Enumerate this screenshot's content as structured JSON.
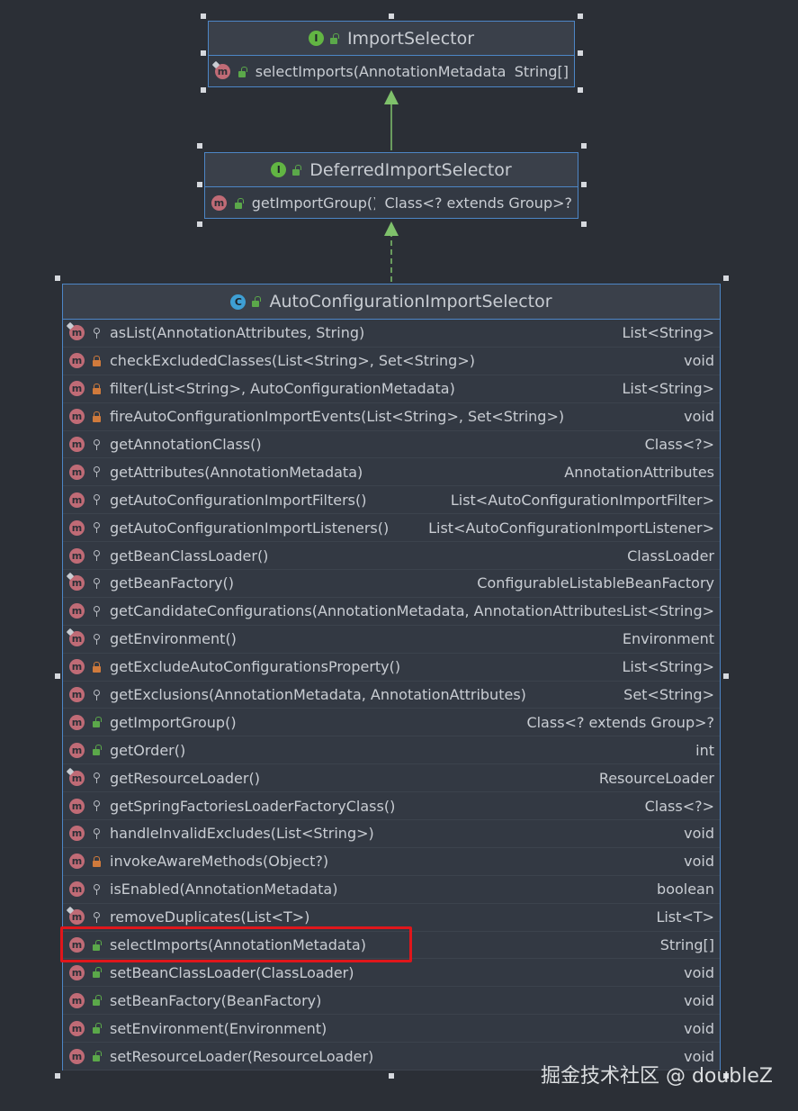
{
  "nodes": {
    "import_selector": {
      "kind_letter": "I",
      "title": "ImportSelector",
      "methods": [
        {
          "name": "selectImports(AnnotationMetadata)",
          "returns": "String[]",
          "visibility": "public",
          "abstract": true
        }
      ]
    },
    "deferred_import_selector": {
      "kind_letter": "I",
      "title": "DeferredImportSelector",
      "methods": [
        {
          "name": "getImportGroup()",
          "returns": "Class<? extends Group>?",
          "visibility": "public",
          "abstract": false
        }
      ]
    },
    "auto_configuration_import_selector": {
      "kind_letter": "C",
      "title": "AutoConfigurationImportSelector",
      "methods": [
        {
          "name": "asList(AnnotationAttributes, String)",
          "returns": "List<String>",
          "visibility": "protected",
          "abstract": true
        },
        {
          "name": "checkExcludedClasses(List<String>, Set<String>)",
          "returns": "void",
          "visibility": "private",
          "abstract": false
        },
        {
          "name": "filter(List<String>, AutoConfigurationMetadata)",
          "returns": "List<String>",
          "visibility": "private",
          "abstract": false
        },
        {
          "name": "fireAutoConfigurationImportEvents(List<String>, Set<String>)",
          "returns": "void",
          "visibility": "private",
          "abstract": false
        },
        {
          "name": "getAnnotationClass()",
          "returns": "Class<?>",
          "visibility": "protected",
          "abstract": false
        },
        {
          "name": "getAttributes(AnnotationMetadata)",
          "returns": "AnnotationAttributes",
          "visibility": "protected",
          "abstract": false
        },
        {
          "name": "getAutoConfigurationImportFilters()",
          "returns": "List<AutoConfigurationImportFilter>",
          "visibility": "protected",
          "abstract": false
        },
        {
          "name": "getAutoConfigurationImportListeners()",
          "returns": "List<AutoConfigurationImportListener>",
          "visibility": "protected",
          "abstract": false
        },
        {
          "name": "getBeanClassLoader()",
          "returns": "ClassLoader",
          "visibility": "protected",
          "abstract": false
        },
        {
          "name": "getBeanFactory()",
          "returns": "ConfigurableListableBeanFactory",
          "visibility": "protected",
          "abstract": true
        },
        {
          "name": "getCandidateConfigurations(AnnotationMetadata, AnnotationAttributes)",
          "returns": "List<String>",
          "visibility": "protected",
          "abstract": false
        },
        {
          "name": "getEnvironment()",
          "returns": "Environment",
          "visibility": "protected",
          "abstract": true
        },
        {
          "name": "getExcludeAutoConfigurationsProperty()",
          "returns": "List<String>",
          "visibility": "private",
          "abstract": false
        },
        {
          "name": "getExclusions(AnnotationMetadata, AnnotationAttributes)",
          "returns": "Set<String>",
          "visibility": "protected",
          "abstract": false
        },
        {
          "name": "getImportGroup()",
          "returns": "Class<? extends Group>?",
          "visibility": "public",
          "abstract": false
        },
        {
          "name": "getOrder()",
          "returns": "int",
          "visibility": "public",
          "abstract": false
        },
        {
          "name": "getResourceLoader()",
          "returns": "ResourceLoader",
          "visibility": "protected",
          "abstract": true
        },
        {
          "name": "getSpringFactoriesLoaderFactoryClass()",
          "returns": "Class<?>",
          "visibility": "protected",
          "abstract": false
        },
        {
          "name": "handleInvalidExcludes(List<String>)",
          "returns": "void",
          "visibility": "protected",
          "abstract": false
        },
        {
          "name": "invokeAwareMethods(Object?)",
          "returns": "void",
          "visibility": "private",
          "abstract": false
        },
        {
          "name": "isEnabled(AnnotationMetadata)",
          "returns": "boolean",
          "visibility": "protected",
          "abstract": false
        },
        {
          "name": "removeDuplicates(List<T>)",
          "returns": "List<T>",
          "visibility": "protected",
          "abstract": true
        },
        {
          "name": "selectImports(AnnotationMetadata)",
          "returns": "String[]",
          "visibility": "public",
          "abstract": false
        },
        {
          "name": "setBeanClassLoader(ClassLoader)",
          "returns": "void",
          "visibility": "public",
          "abstract": false
        },
        {
          "name": "setBeanFactory(BeanFactory)",
          "returns": "void",
          "visibility": "public",
          "abstract": false
        },
        {
          "name": "setEnvironment(Environment)",
          "returns": "void",
          "visibility": "public",
          "abstract": false
        },
        {
          "name": "setResourceLoader(ResourceLoader)",
          "returns": "void",
          "visibility": "public",
          "abstract": false
        }
      ]
    }
  },
  "method_icon_letter": "m",
  "edges": [
    {
      "from": "deferred_import_selector",
      "to": "import_selector",
      "type": "extends",
      "style": "solid"
    },
    {
      "from": "auto_configuration_import_selector",
      "to": "deferred_import_selector",
      "type": "implements",
      "style": "dashed"
    }
  ],
  "highlighted_method": "selectImports(AnnotationMetadata)",
  "colors": {
    "background": "#2b2f36",
    "node_border": "#4d86c6",
    "edge": "#7fc16b",
    "highlight": "#e0161b"
  },
  "watermark": "掘金技术社区 @ doubleZ"
}
